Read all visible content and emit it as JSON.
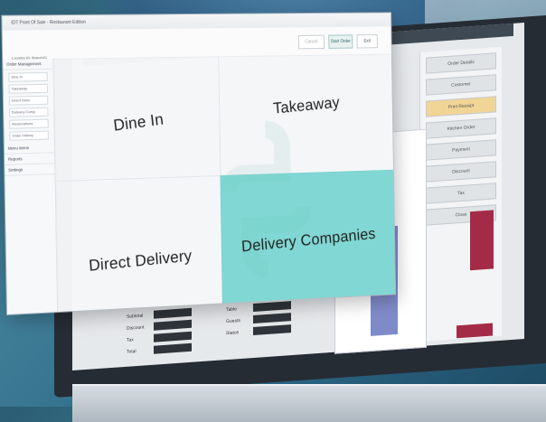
{
  "window": {
    "title": "IDT Point Of Sale - Restaurant Edition",
    "subtitle": "Dine In",
    "meta_line1": "Location ID:  Branch01",
    "meta_line2": "Station ID:  POS1"
  },
  "toolbar": {
    "cancel_label": "Cancel",
    "start_label": "Start Order",
    "exit_label": "Exit"
  },
  "sidebar": {
    "sections": [
      {
        "heading": "Order Management",
        "items": [
          "Dine In",
          "Takeaway",
          "Direct Deliv",
          "Delivery Comp",
          "Reservations",
          "Order History"
        ]
      },
      {
        "heading": "Menu Items"
      },
      {
        "heading": "Reports"
      },
      {
        "heading": "Settings"
      }
    ]
  },
  "order_types": [
    "Dine In",
    "Takeaway",
    "Direct Delivery",
    "Delivery Companies"
  ],
  "selected_order_type": "Delivery Companies",
  "background_app": {
    "panel_buttons": [
      "Order Details",
      "Customer",
      "Print Receipt",
      "Kitchen Order",
      "Payment",
      "Discount",
      "Tax",
      "Close"
    ],
    "rows": [
      "Subtotal",
      "Discount",
      "Tax",
      "Total"
    ],
    "right_rows": [
      "Table",
      "Guests",
      "Status"
    ]
  },
  "colors": {
    "accent": "#6dd2cd",
    "bg": "#2b5d73",
    "behind_bar_blue": "#7f8bc9",
    "behind_bar_red": "#a42b47",
    "highlight_yellow": "#f1d597"
  }
}
